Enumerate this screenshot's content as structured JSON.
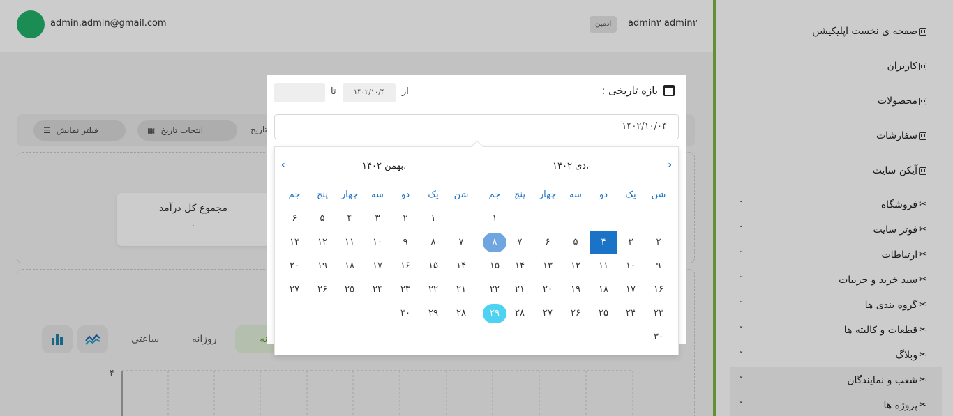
{
  "header": {
    "email": "admin.admin@gmail.com",
    "role": "ادمین",
    "username": "admin۲ admin۲"
  },
  "page": {
    "heading": "",
    "filter_button": "فیلتر نمایش",
    "date_button": "انتخاب تاریخ",
    "date_label": "تاریخ :",
    "income_title": "مجموع کل درآمد",
    "income_value": "۰",
    "tabs": {
      "monthly": "ماهانه",
      "daily": "روزانه",
      "hourly": "ساعتی"
    },
    "chart_ytick": "۴"
  },
  "sidebar": {
    "items": [
      {
        "label": "صفحه ی نخست اپلیکیشن",
        "icon": "app-icon",
        "expandable": false
      },
      {
        "label": "کاربران",
        "icon": "app-icon",
        "expandable": false
      },
      {
        "label": "محصولات",
        "icon": "app-icon",
        "expandable": false
      },
      {
        "label": "سفارشات",
        "icon": "app-icon",
        "expandable": false
      },
      {
        "label": "آیکن سایت",
        "icon": "app-icon",
        "expandable": false
      },
      {
        "label": "فروشگاه",
        "icon": "tools-icon",
        "expandable": true
      },
      {
        "label": "فوتر سایت",
        "icon": "tools-icon",
        "expandable": true
      },
      {
        "label": "ارتباطات",
        "icon": "tools-icon",
        "expandable": true
      },
      {
        "label": "سبد خرید و جزییات",
        "icon": "tools-icon",
        "expandable": true
      },
      {
        "label": "گروه بندی ها",
        "icon": "tools-icon",
        "expandable": true
      },
      {
        "label": "قطعات و کالیته ها",
        "icon": "tools-icon",
        "expandable": true
      },
      {
        "label": "وبلاگ",
        "icon": "tools-icon",
        "expandable": true
      },
      {
        "label": "شعب و نمایندگان",
        "icon": "tools-icon",
        "expandable": true
      },
      {
        "label": "پروژه ها",
        "icon": "tools-icon",
        "expandable": true
      }
    ]
  },
  "modal": {
    "title": "بازه تاریخی :",
    "from_label": "از",
    "to_label": "تا",
    "from_value": "۱۴۰۲/۱۰/۴",
    "to_value": "",
    "input_value": "۱۴۰۲/۱۰/۰۴"
  },
  "calendar": {
    "weekdays": [
      "شن",
      "یک",
      "دو",
      "سه",
      "چهار",
      "پنج",
      "جم"
    ],
    "months": [
      {
        "title": "دی ۱۴۰۲،",
        "weeks": [
          [
            "",
            "",
            "",
            "",
            "",
            "",
            "۱"
          ],
          [
            "۲",
            "۳",
            "۴",
            "۵",
            "۶",
            "۷",
            "۸"
          ],
          [
            "۹",
            "۱۰",
            "۱۱",
            "۱۲",
            "۱۳",
            "۱۴",
            "۱۵"
          ],
          [
            "۱۶",
            "۱۷",
            "۱۸",
            "۱۹",
            "۲۰",
            "۲۱",
            "۲۲"
          ],
          [
            "۲۳",
            "۲۴",
            "۲۵",
            "۲۶",
            "۲۷",
            "۲۸",
            "۲۹"
          ],
          [
            "۳۰",
            "",
            "",
            "",
            "",
            "",
            ""
          ]
        ],
        "selected": "۴",
        "highlight": "۸",
        "today": "۲۹"
      },
      {
        "title": "بهمن ۱۴۰۲،",
        "weeks": [
          [
            "",
            "۱",
            "۲",
            "۳",
            "۴",
            "۵",
            "۶"
          ],
          [
            "۷",
            "۸",
            "۹",
            "۱۰",
            "۱۱",
            "۱۲",
            "۱۳"
          ],
          [
            "۱۴",
            "۱۵",
            "۱۶",
            "۱۷",
            "۱۸",
            "۱۹",
            "۲۰"
          ],
          [
            "۲۱",
            "۲۲",
            "۲۳",
            "۲۴",
            "۲۵",
            "۲۶",
            "۲۷"
          ],
          [
            "۲۸",
            "۲۹",
            "۳۰",
            "",
            "",
            "",
            ""
          ]
        ]
      }
    ]
  }
}
